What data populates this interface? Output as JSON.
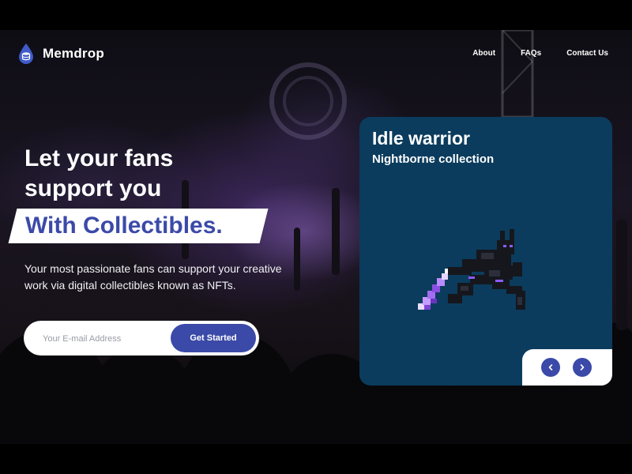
{
  "brand": {
    "name": "Memdrop",
    "logo_icon": "droplet-database-icon",
    "accent": "#3b4aa8"
  },
  "nav": {
    "links": [
      {
        "label": "About"
      },
      {
        "label": "FAQs"
      },
      {
        "label": "Contact Us"
      }
    ]
  },
  "hero": {
    "headline_line1": "Let your fans",
    "headline_line2": "support you",
    "highlight": "With Collectibles.",
    "subtext": "Your most passionate fans can support your creative work via digital collectibles known as NFTs.",
    "email_placeholder": "Your E-mail Address",
    "cta_label": "Get Started"
  },
  "card": {
    "title": "Idle warrior",
    "subtitle": "Nightborne collection",
    "background": "#0b3c5d",
    "prev_icon": "chevron-left-icon",
    "next_icon": "chevron-right-icon"
  }
}
